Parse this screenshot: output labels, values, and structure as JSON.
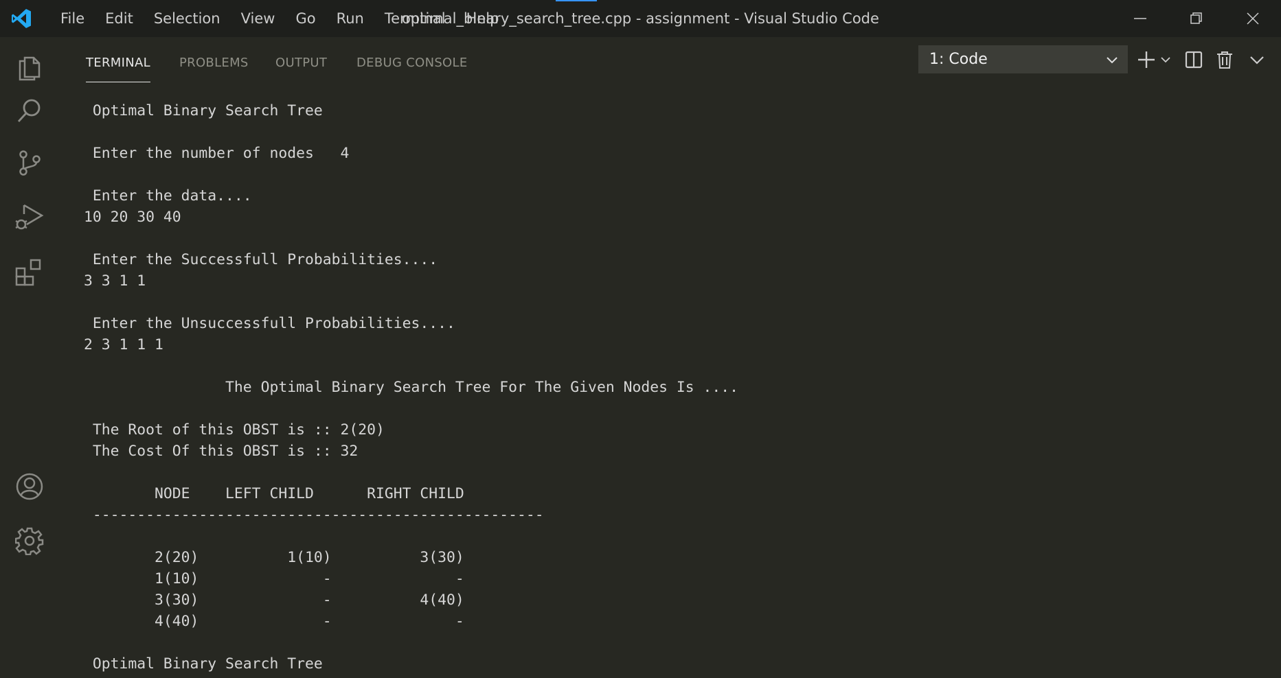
{
  "window": {
    "title": "optimal_binary_search_tree.cpp - assignment - Visual Studio Code",
    "menu": [
      "File",
      "Edit",
      "Selection",
      "View",
      "Go",
      "Run",
      "Terminal",
      "Help"
    ]
  },
  "activity_bar": {
    "icons": [
      "files-icon",
      "search-icon",
      "source-control-icon",
      "run-debug-icon",
      "extensions-icon",
      "account-icon",
      "settings-gear-icon"
    ]
  },
  "panel": {
    "tabs": [
      {
        "label": "TERMINAL",
        "active": true
      },
      {
        "label": "PROBLEMS",
        "active": false
      },
      {
        "label": "OUTPUT",
        "active": false
      },
      {
        "label": "DEBUG CONSOLE",
        "active": false
      }
    ],
    "terminal_selector": {
      "selected": "1: Code"
    }
  },
  "terminal": {
    "lines": [
      " Optimal Binary Search Tree",
      "",
      " Enter the number of nodes   4",
      "",
      " Enter the data....",
      "10 20 30 40",
      "",
      " Enter the Successfull Probabilities....",
      "3 3 1 1",
      "",
      " Enter the Unsuccessfull Probabilities....",
      "2 3 1 1 1",
      "",
      "                The Optimal Binary Search Tree For The Given Nodes Is ....",
      "",
      " The Root of this OBST is :: 2(20)",
      " The Cost Of this OBST is :: 32",
      "",
      "        NODE    LEFT CHILD      RIGHT CHILD",
      " ---------------------------------------------------",
      "",
      "        2(20)          1(10)          3(30)",
      "        1(10)              -              -",
      "        3(30)              -          4(40)",
      "        4(40)              -              -",
      "",
      " Optimal Binary Search Tree"
    ]
  },
  "colors": {
    "background": "#272822",
    "titlebar": "#1e1f1c",
    "accent": "#3794ff",
    "text": "#d6d6d6"
  }
}
